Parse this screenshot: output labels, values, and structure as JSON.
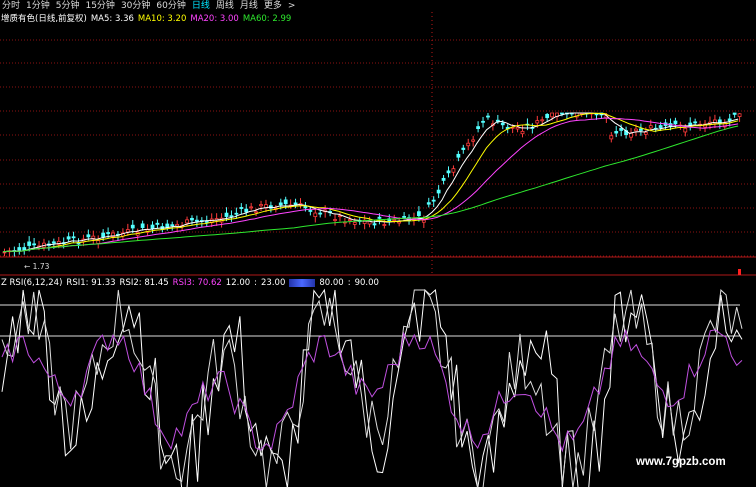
{
  "toolbar": {
    "tabs": [
      "分时",
      "1分钟",
      "5分钟",
      "15分钟",
      "30分钟",
      "60分钟",
      "日线",
      "周线",
      "月线",
      "更多"
    ],
    "active_tab": "日线",
    "more_arrow": ">"
  },
  "price_legend": {
    "main_label": "增质有色(日线,前复权)",
    "ma5": "MA5: 3.36",
    "ma10": "MA10: 3.20",
    "ma20": "MA20: 3.00",
    "ma60": "MA60: 2.99"
  },
  "low_marker": "1.73",
  "rsi_legend": {
    "label": "Z RSI(6,12,24)",
    "rsi1": "RSI1: 91.33",
    "rsi2": "RSI2: 81.45",
    "rsi3": "RSI3: 70.62",
    "v1": "12.00",
    "v2": "23.00",
    "v3": "80.00",
    "v4": "90.00",
    "sep": ":"
  },
  "watermark": "www.7gpzb.com",
  "colors": {
    "up": "#ff3b3b",
    "down": "#54ffff",
    "ma5": "#ffffff",
    "ma10": "#ffff00",
    "ma20": "#ff44ff",
    "ma60": "#2ee82e",
    "rsi1": "#ffffff",
    "rsi2": "#dddddd",
    "rsi3": "#c050e0",
    "grid_red": "#8c1212",
    "active_tab": "#00e5ff",
    "blue": "#4a68ff"
  }
}
